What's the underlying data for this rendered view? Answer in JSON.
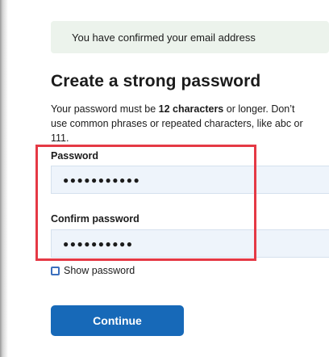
{
  "alert": {
    "message": "You have confirmed your email address"
  },
  "page": {
    "title": "Create a strong password",
    "intro_prefix": "Your password must be ",
    "intro_bold": "12 characters",
    "intro_suffix": " or longer. Don’t use common phrases or repeated characters, like abc or 111."
  },
  "password_field": {
    "label": "Password",
    "value": "●●●●●●●●●●●"
  },
  "confirm_field": {
    "label": "Confirm password",
    "value": "●●●●●●●●●●"
  },
  "show_password": {
    "label": "Show password",
    "checked": false
  },
  "continue_button": {
    "label": "Continue"
  },
  "colors": {
    "highlight": "#e53945",
    "primary": "#1769b8",
    "alert_bg": "#ecf3ec",
    "input_bg": "#eef4fb"
  }
}
